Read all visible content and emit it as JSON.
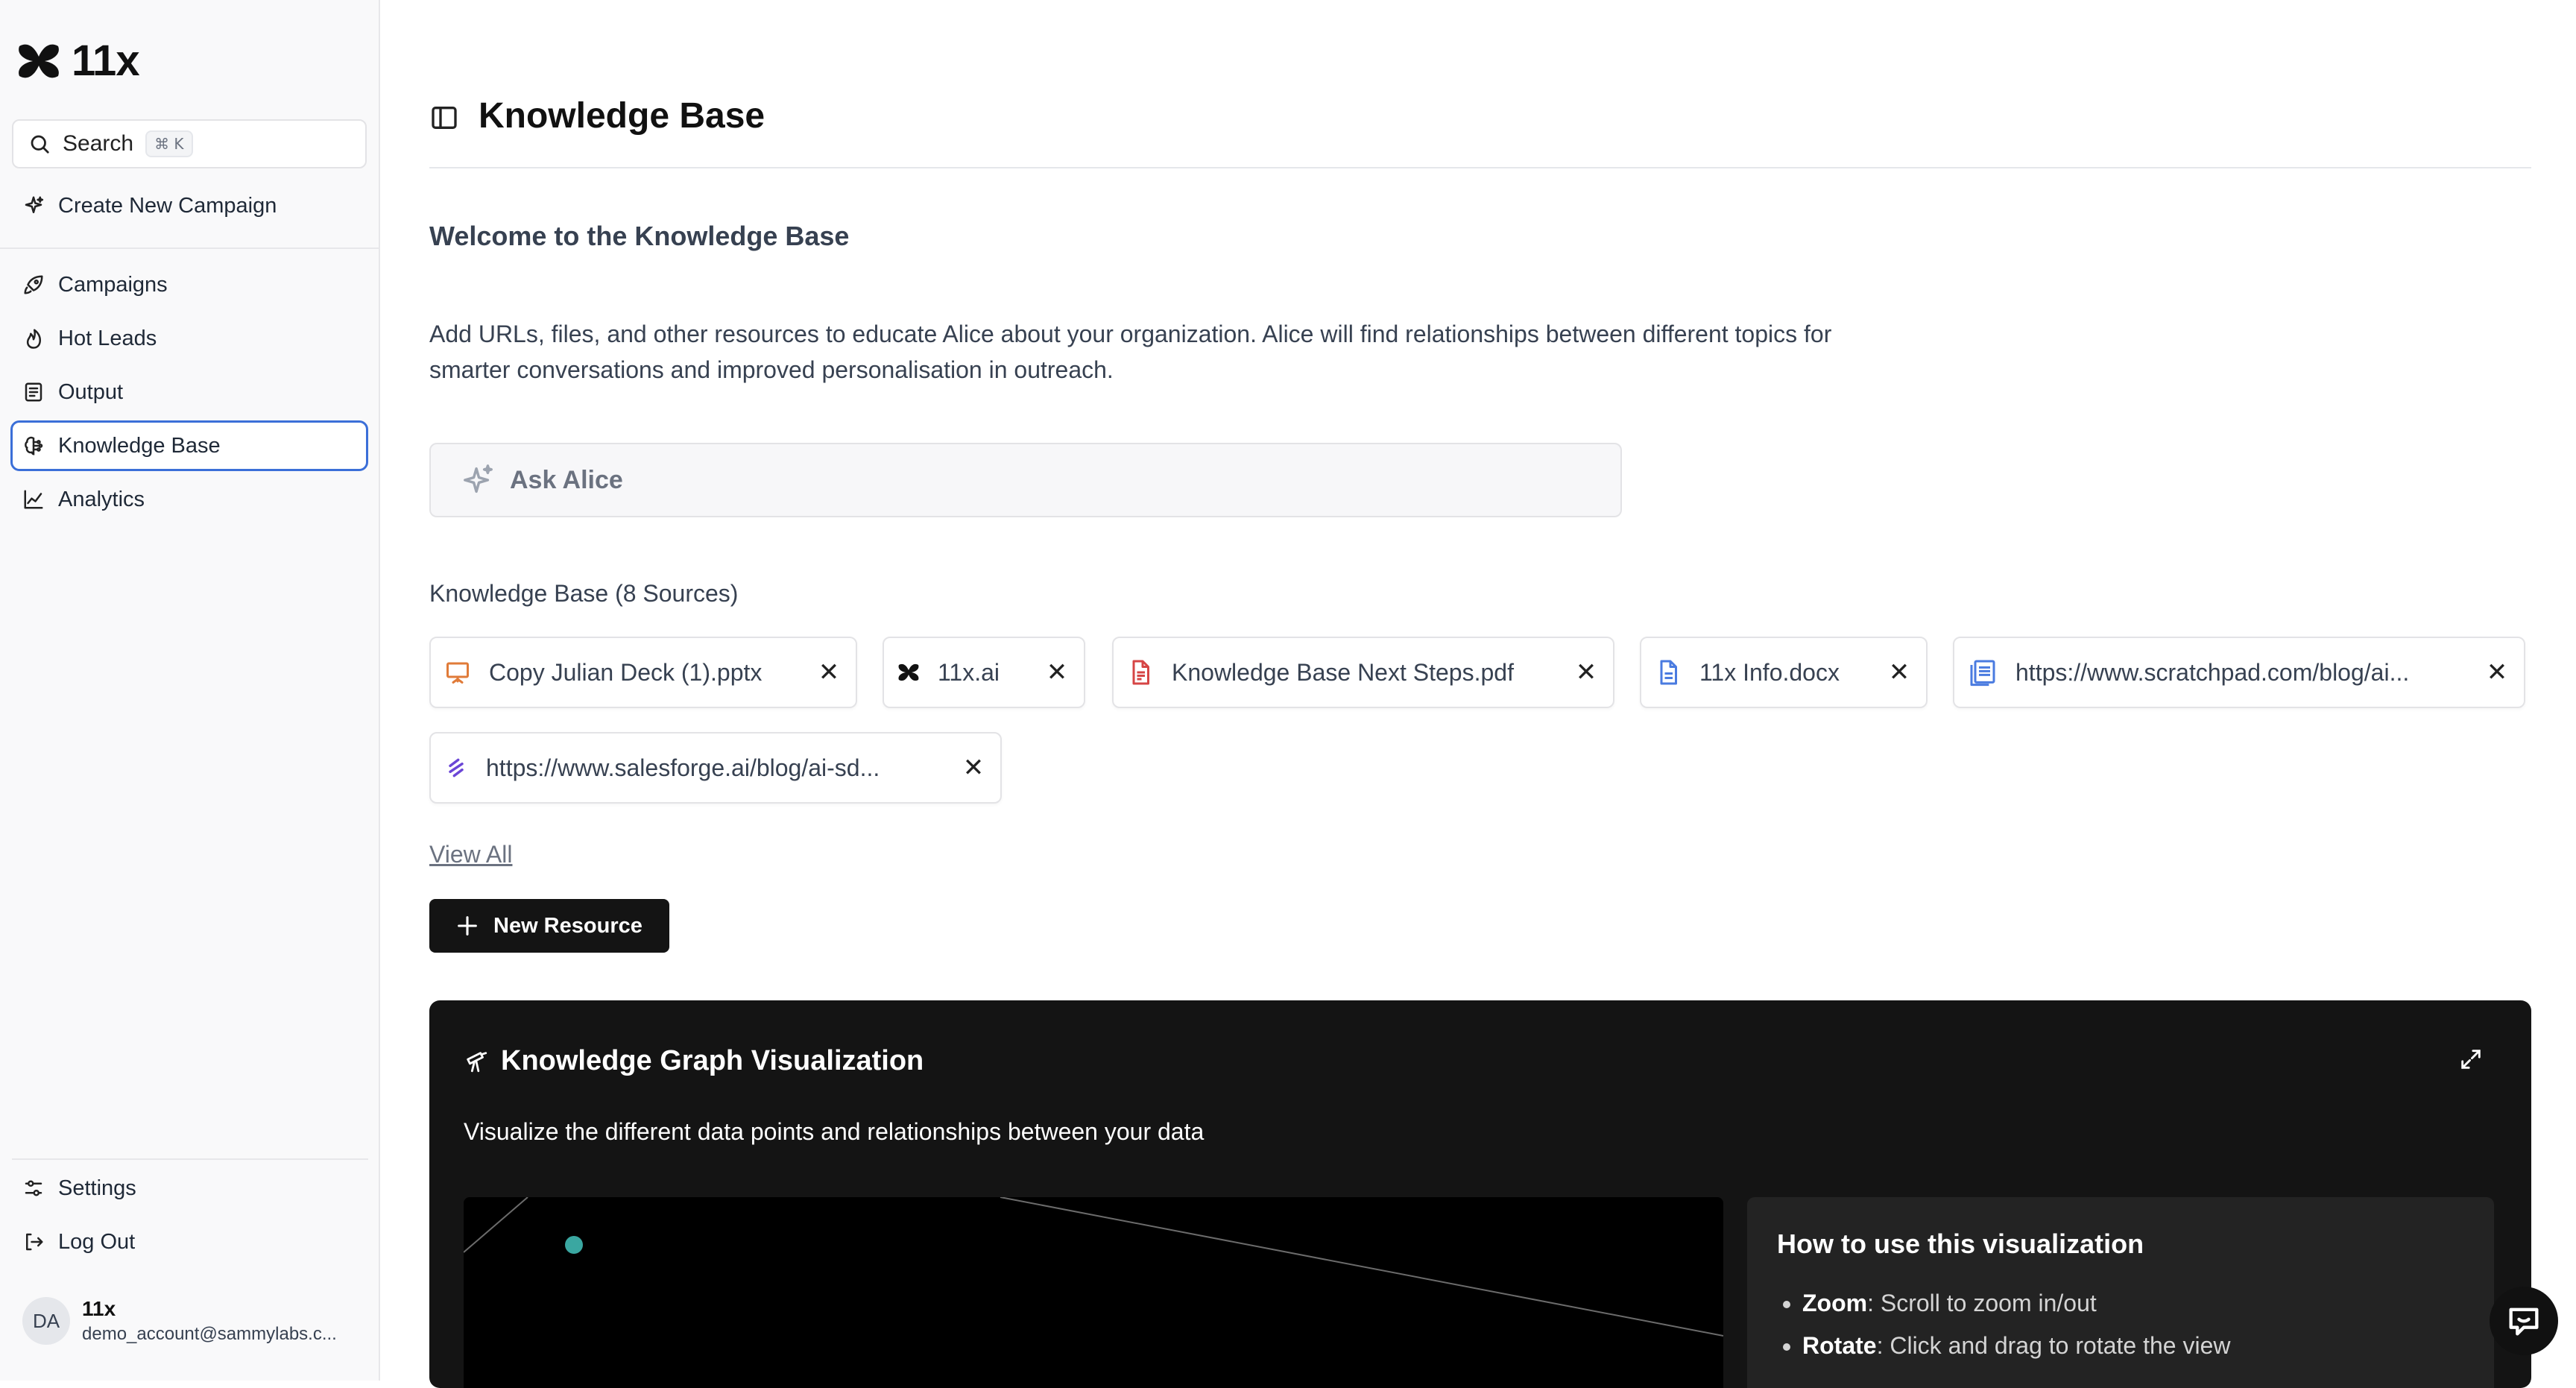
{
  "app": {
    "logo_text": "11x",
    "search_label": "Search",
    "search_shortcut": "⌘ K"
  },
  "sidebar": {
    "create_campaign": "Create New Campaign",
    "items": [
      {
        "label": "Campaigns",
        "icon": "rocket-icon"
      },
      {
        "label": "Hot Leads",
        "icon": "flame-icon"
      },
      {
        "label": "Output",
        "icon": "list-icon"
      },
      {
        "label": "Knowledge Base",
        "icon": "brain-icon",
        "active": true
      },
      {
        "label": "Analytics",
        "icon": "chart-icon"
      }
    ],
    "settings": "Settings",
    "logout": "Log Out",
    "user": {
      "initials": "DA",
      "name": "11x",
      "email": "demo_account@sammylabs.c..."
    }
  },
  "page": {
    "title": "Knowledge Base",
    "welcome": "Welcome to the Knowledge Base",
    "description": "Add URLs, files, and other resources to educate Alice about your organization. Alice will find relationships between different topics for smarter conversations and improved personalisation in outreach.",
    "ask_placeholder": "Ask Alice",
    "kb_count": "Knowledge Base (8 Sources)",
    "view_all": "View All",
    "new_resource": "New Resource"
  },
  "sources": [
    {
      "label": "Copy Julian Deck (1).pptx",
      "icon": "presentation-icon"
    },
    {
      "label": "11x.ai",
      "icon": "11x-logo-icon"
    },
    {
      "label": "Knowledge Base Next Steps.pdf",
      "icon": "pdf-icon"
    },
    {
      "label": "11x Info.docx",
      "icon": "doc-icon"
    },
    {
      "label": "https://www.scratchpad.com/blog/ai...",
      "icon": "web-page-icon"
    },
    {
      "label": "https://www.salesforge.ai/blog/ai-sd...",
      "icon": "salesforge-icon"
    }
  ],
  "graph": {
    "title": "Knowledge Graph Visualization",
    "description": "Visualize the different data points and relationships between your data",
    "howto_title": "How to use this visualization",
    "tips": [
      {
        "term": "Zoom",
        "text": ": Scroll to zoom in/out"
      },
      {
        "term": "Rotate",
        "text": ": Click and drag to rotate the view"
      }
    ]
  },
  "colors": {
    "accent": "#3b6fd8",
    "graph_node": "#3aa7a1",
    "pptx": "#e07b39",
    "pdf": "#d64545",
    "docx": "#4a7be0",
    "salesforge": "#6b46d6"
  }
}
